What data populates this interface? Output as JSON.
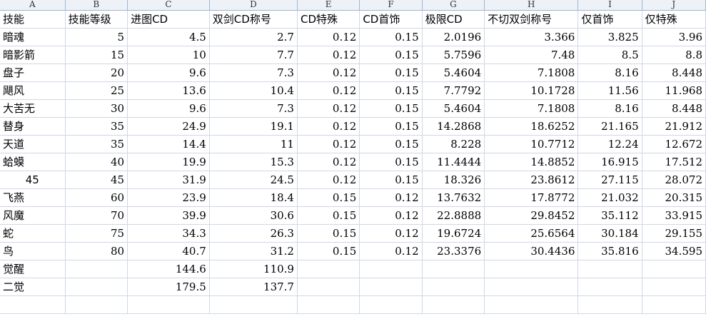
{
  "column_letters": [
    "A",
    "B",
    "C",
    "D",
    "E",
    "F",
    "G",
    "H",
    "I",
    "J"
  ],
  "rows": [
    [
      "技能",
      "技能等级",
      "进图CD",
      "双剑CD称号",
      "CD特殊",
      "CD首饰",
      "极限CD",
      "不切双剑称号",
      "仅首饰",
      "仅特殊"
    ],
    [
      "暗魂",
      "5",
      "4.5",
      "2.7",
      "0.12",
      "0.15",
      "2.0196",
      "3.366",
      "3.825",
      "3.96"
    ],
    [
      "暗影箭",
      "15",
      "10",
      "7.7",
      "0.12",
      "0.15",
      "5.7596",
      "7.48",
      "8.5",
      "8.8"
    ],
    [
      "盘子",
      "20",
      "9.6",
      "7.3",
      "0.12",
      "0.15",
      "5.4604",
      "7.1808",
      "8.16",
      "8.448"
    ],
    [
      "飓风",
      "25",
      "13.6",
      "10.4",
      "0.12",
      "0.15",
      "7.7792",
      "10.1728",
      "11.56",
      "11.968"
    ],
    [
      "大苦无",
      "30",
      "9.6",
      "7.3",
      "0.12",
      "0.15",
      "5.4604",
      "7.1808",
      "8.16",
      "8.448"
    ],
    [
      "替身",
      "35",
      "24.9",
      "19.1",
      "0.12",
      "0.15",
      "14.2868",
      "18.6252",
      "21.165",
      "21.912"
    ],
    [
      "天道",
      "35",
      "14.4",
      "11",
      "0.12",
      "0.15",
      "8.228",
      "10.7712",
      "12.24",
      "12.672"
    ],
    [
      "蛤蟆",
      "40",
      "19.9",
      "15.3",
      "0.12",
      "0.15",
      "11.4444",
      "14.8852",
      "16.915",
      "17.512"
    ],
    [
      "45",
      "45",
      "31.9",
      "24.5",
      "0.12",
      "0.15",
      "18.326",
      "23.8612",
      "27.115",
      "28.072"
    ],
    [
      "飞燕",
      "60",
      "23.9",
      "18.4",
      "0.15",
      "0.12",
      "13.7632",
      "17.8772",
      "21.032",
      "20.315"
    ],
    [
      "风魔",
      "70",
      "39.9",
      "30.6",
      "0.15",
      "0.12",
      "22.8888",
      "29.8452",
      "35.112",
      "33.915"
    ],
    [
      "蛇",
      "75",
      "34.3",
      "26.3",
      "0.15",
      "0.12",
      "19.6724",
      "25.6564",
      "30.184",
      "29.155"
    ],
    [
      "鸟",
      "80",
      "40.7",
      "31.2",
      "0.15",
      "0.12",
      "23.3376",
      "30.4436",
      "35.816",
      "34.595"
    ],
    [
      "觉醒",
      "",
      "144.6",
      "110.9",
      "",
      "",
      "",
      "",
      "",
      ""
    ],
    [
      "二觉",
      "",
      "179.5",
      "137.7",
      "",
      "",
      "",
      "",
      "",
      ""
    ],
    [
      "",
      "",
      "",
      "",
      "",
      "",
      "",
      "",
      "",
      ""
    ]
  ]
}
